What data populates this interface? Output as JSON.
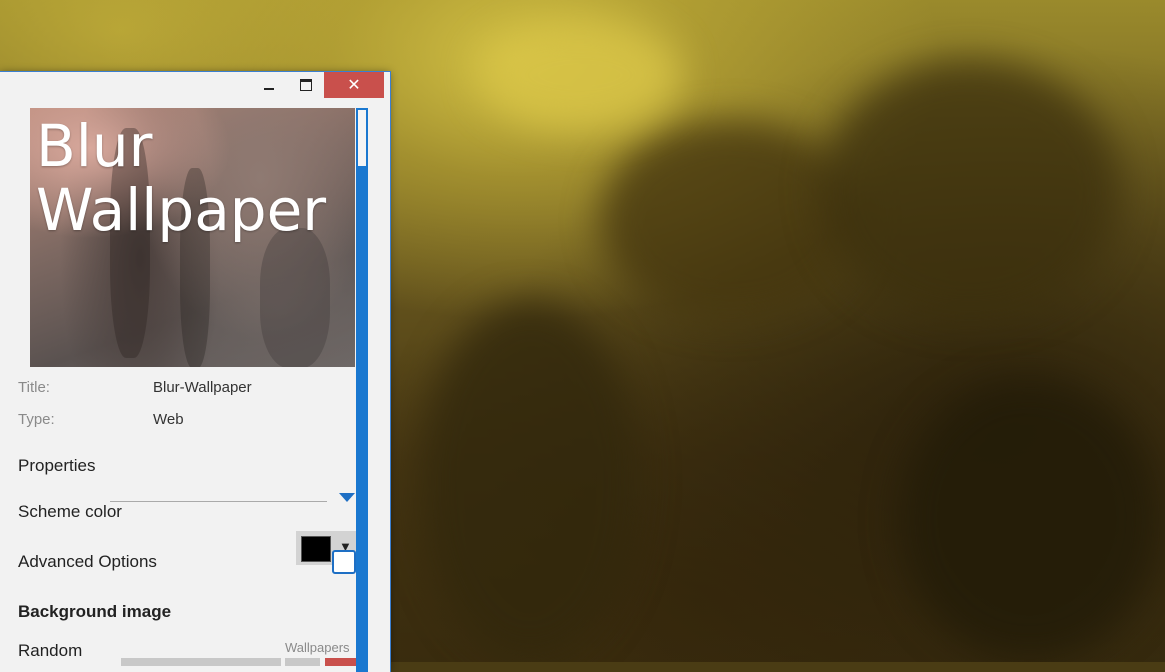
{
  "window": {
    "minimize_label": "",
    "close_label": "✕"
  },
  "preview": {
    "title": "Blur Wallpaper"
  },
  "details": {
    "title_label": "Title:",
    "title_value": "Blur-Wallpaper",
    "type_label": "Type:",
    "type_value": "Web"
  },
  "properties": {
    "header": "Properties",
    "scheme_color_label": "Scheme color",
    "scheme_color_value": "#000000",
    "dropdown_arrow": "▼",
    "advanced_options_label": "Advanced Options",
    "advanced_options_checked": false,
    "background_image_header": "Background image",
    "random_label": "Random",
    "wallpapers_label": "Wallpapers"
  },
  "colors": {
    "accent": "#1a78d0",
    "close_button": "#c9504c"
  }
}
